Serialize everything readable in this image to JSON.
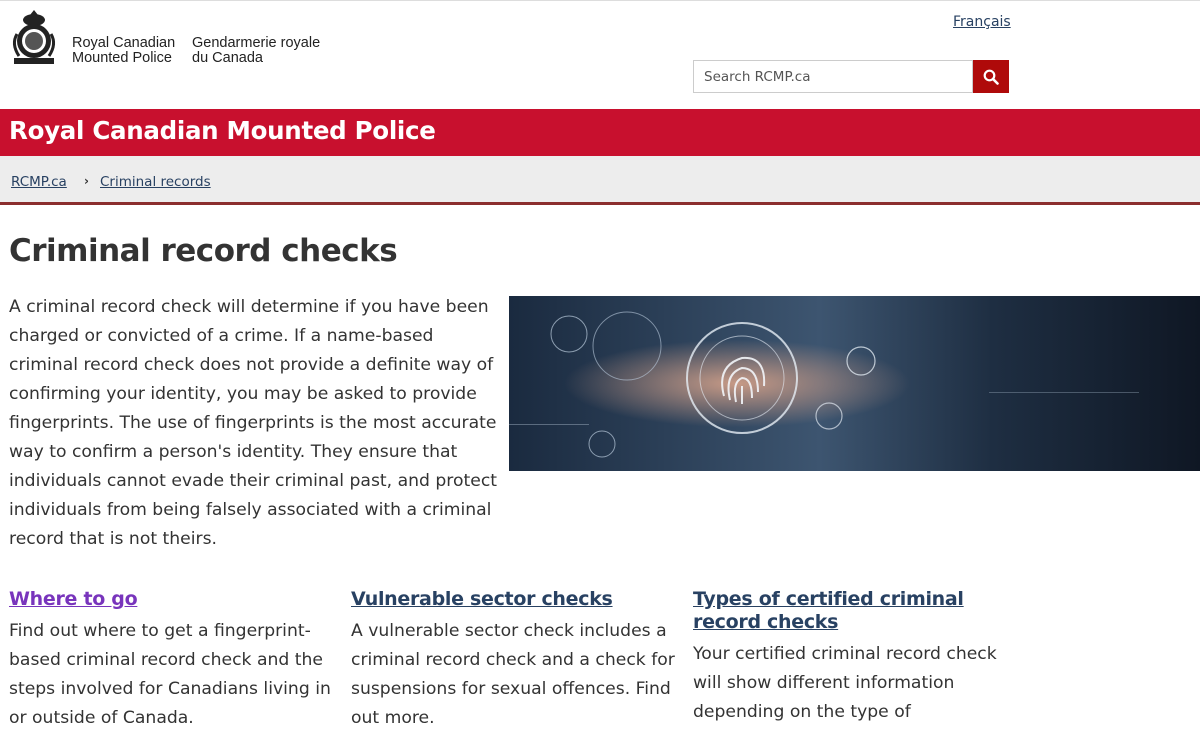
{
  "header": {
    "signature_en_line1": "Royal Canadian",
    "signature_en_line2": "Mounted Police",
    "signature_fr_line1": "Gendarmerie royale",
    "signature_fr_line2": "du Canada",
    "language_link": "Français",
    "search_placeholder": "Search RCMP.ca",
    "search_icon": "search-icon"
  },
  "banner": {
    "title": "Royal Canadian Mounted Police"
  },
  "breadcrumb": {
    "items": [
      {
        "label": "RCMP.ca"
      },
      {
        "label": "Criminal records"
      }
    ]
  },
  "main": {
    "title": "Criminal record checks",
    "intro": "A criminal record check will determine if you have been charged or convicted of a crime. If a name-based criminal record check does not provide a definite way of confirming your identity, you may be asked to provide fingerprints. The use of fingerprints is the most accurate way to confirm a person's identity. They ensure that individuals cannot evade their criminal past, and protect individuals from being falsely associated with a criminal record that is not theirs.",
    "cards": [
      {
        "title": "Where to go",
        "text": "Find out where to get a fingerprint-based criminal record check and the steps involved for Canadians living in or outside of Canada."
      },
      {
        "title": "Vulnerable sector checks",
        "text": "A vulnerable sector check includes a criminal record check and a check for suspensions for sexual offences. Find out more."
      },
      {
        "title": "Types of certified criminal record checks",
        "text": "Your certified criminal record check will show different information depending on the type of"
      }
    ]
  },
  "colors": {
    "accent_red": "#c8102e",
    "link": "#284162",
    "visited_link": "#7834bc",
    "search_button": "#af0a0a"
  }
}
